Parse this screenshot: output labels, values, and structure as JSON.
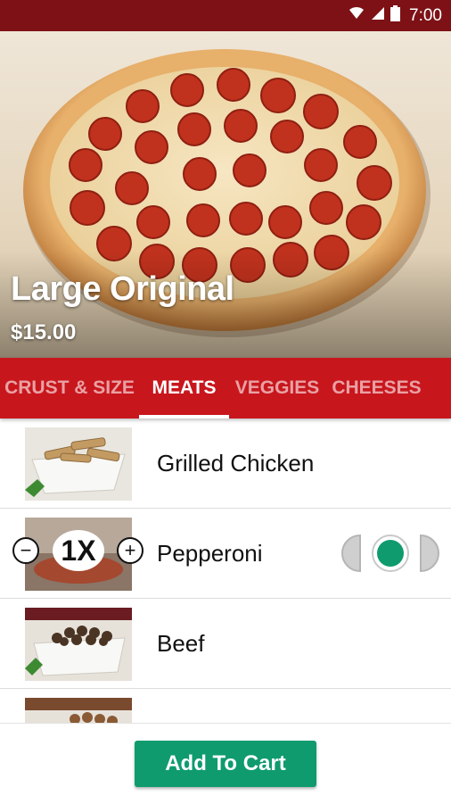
{
  "status_bar": {
    "time": "7:00"
  },
  "hero": {
    "title": "Large Original",
    "price": "$15.00"
  },
  "tabs": [
    {
      "label": "CRUST & SIZE",
      "active": false
    },
    {
      "label": "MEATS",
      "active": true
    },
    {
      "label": "VEGGIES",
      "active": false
    },
    {
      "label": "CHEESES",
      "active": false
    }
  ],
  "toppings": [
    {
      "name": "Grilled Chicken",
      "selected": false
    },
    {
      "name": "Pepperoni",
      "selected": true,
      "quantity": "1X",
      "portion": "whole"
    },
    {
      "name": "Beef",
      "selected": false
    },
    {
      "name": "",
      "selected": false
    }
  ],
  "footer": {
    "add_label": "Add To Cart"
  },
  "colors": {
    "status_bar": "#7d1116",
    "tab_bar": "#c8161d",
    "accent_green": "#0f9b6e"
  },
  "icons": {
    "wifi": "wifi-icon",
    "signal": "signal-icon",
    "battery": "battery-icon",
    "minus": "minus-circle-icon",
    "plus": "plus-circle-icon"
  }
}
